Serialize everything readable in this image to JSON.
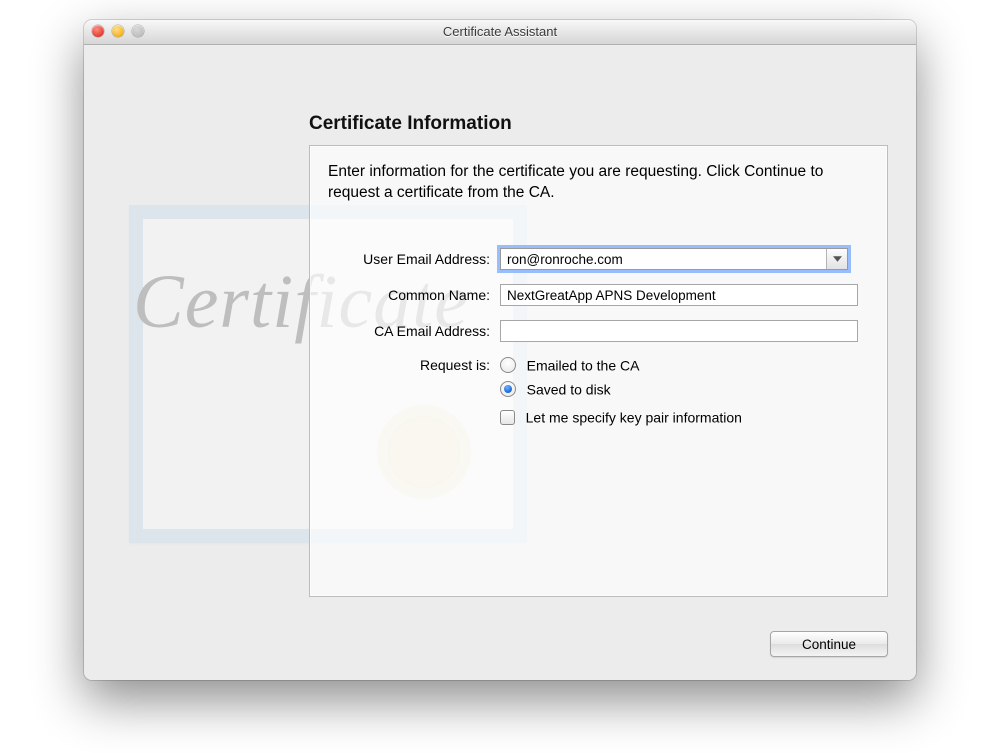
{
  "window": {
    "title": "Certificate Assistant"
  },
  "heading": "Certificate Information",
  "instructions": "Enter information for the certificate you are requesting. Click Continue to request a certificate from the CA.",
  "labels": {
    "user_email": "User Email Address:",
    "common_name": "Common Name:",
    "ca_email": "CA Email Address:",
    "request_is": "Request is:"
  },
  "fields": {
    "user_email": "ron@ronroche.com",
    "common_name": "NextGreatApp APNS Development",
    "ca_email": ""
  },
  "options": {
    "emailed": "Emailed to the CA",
    "saved": "Saved to disk",
    "keypair": "Let me specify key pair information"
  },
  "buttons": {
    "continue": "Continue"
  }
}
